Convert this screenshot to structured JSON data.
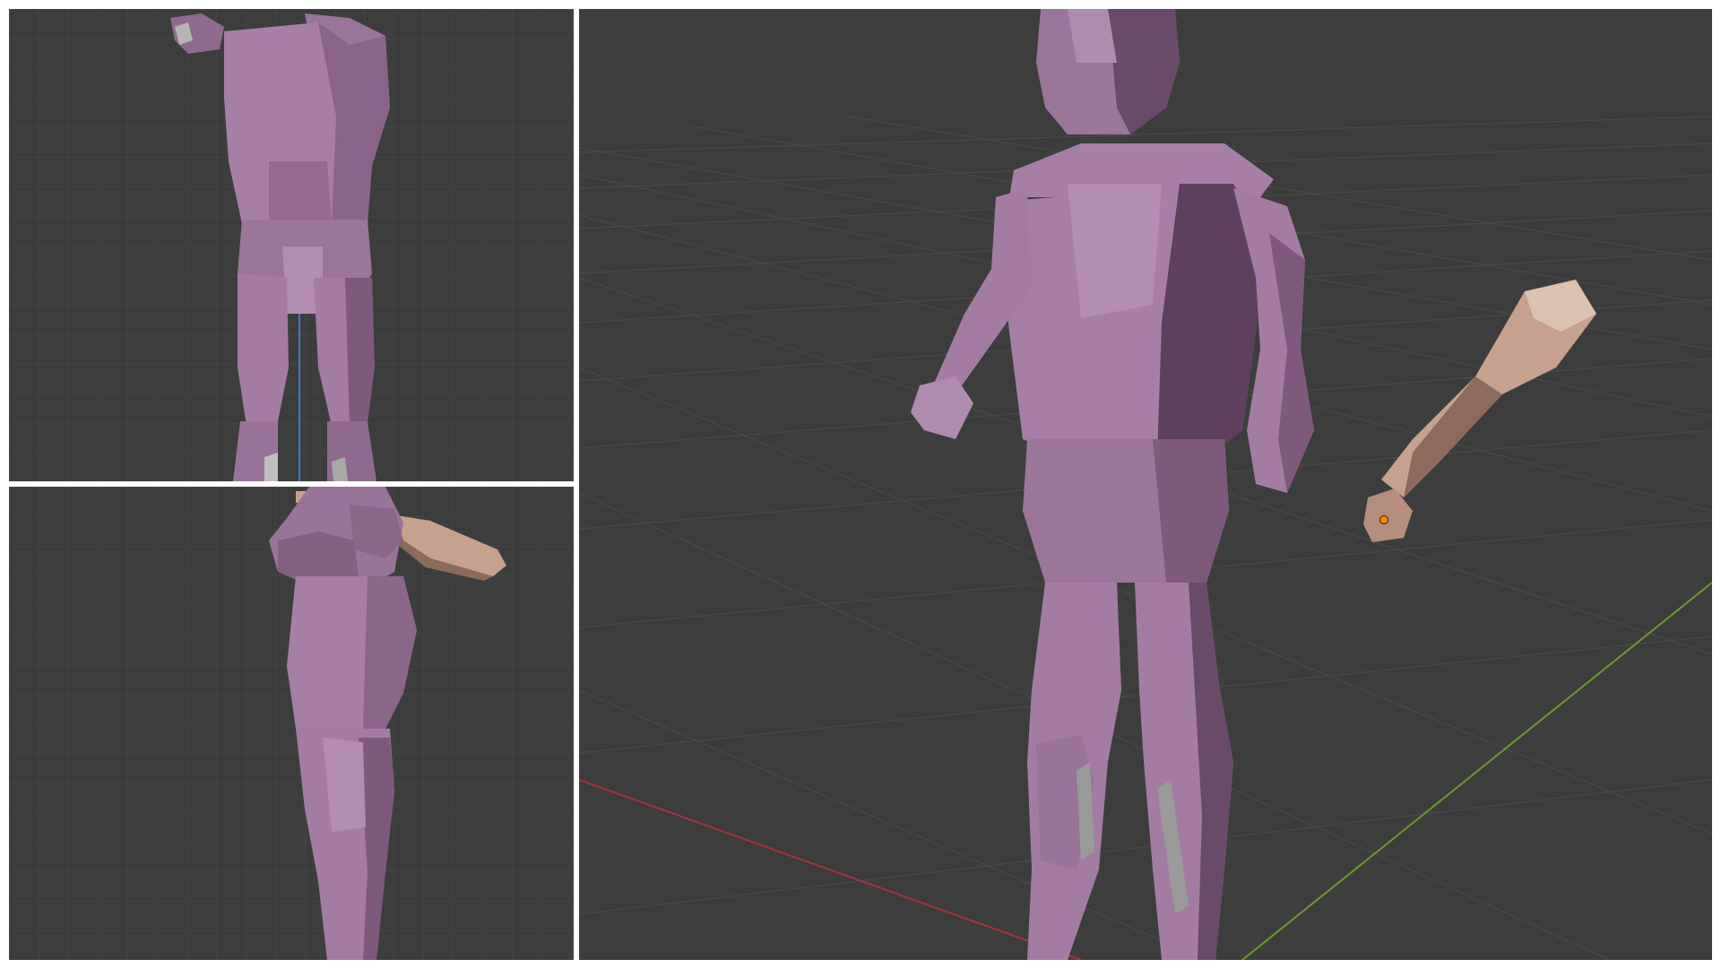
{
  "viewports": [
    {
      "view": "front",
      "projection": "orthographic"
    },
    {
      "view": "side",
      "projection": "orthographic"
    },
    {
      "view": "perspective",
      "projection": "perspective"
    }
  ],
  "scene": {
    "objects": [
      "character-body",
      "wooden-club"
    ]
  },
  "colors": {
    "viewport_background": "#3d3d3d",
    "grid_line": "#4a4a4a",
    "body_light": "#a77fa6",
    "body_mid": "#936b91",
    "body_dark": "#5e3f5d",
    "club_light": "#c7a08e",
    "club_dark": "#8c6a5c",
    "x_axis": "#a3343e",
    "y_axis": "#6a9b2c",
    "z_axis": "#3a7bc8",
    "origin_marker": "#ff8800"
  }
}
